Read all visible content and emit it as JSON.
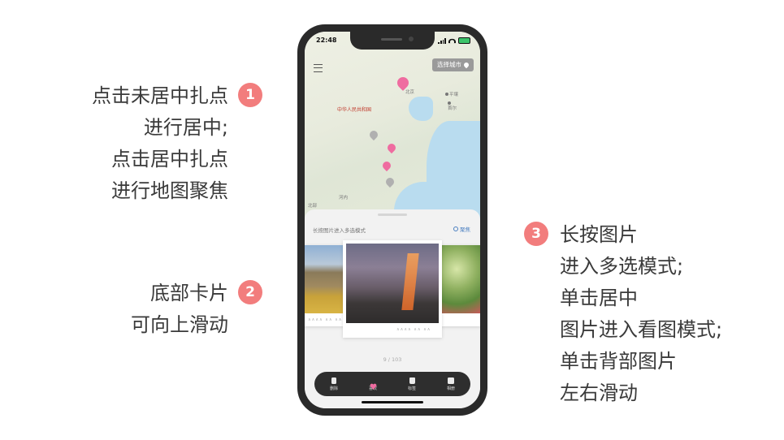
{
  "annotations": {
    "a1": {
      "number": "1",
      "lines": [
        "点击未居中扎点",
        "进行居中;",
        "点击居中扎点",
        "进行地图聚焦"
      ]
    },
    "a2": {
      "number": "2",
      "lines": [
        "底部卡片",
        "可向上滑动"
      ]
    },
    "a3": {
      "number": "3",
      "lines": [
        "长按图片",
        "进入多选模式;",
        "单击居中",
        "图片进入看图模式;",
        "单击背部图片",
        "左右滑动"
      ]
    }
  },
  "phone": {
    "status": {
      "time": "22:48"
    },
    "map": {
      "city_button": "选择城市",
      "labels": {
        "beijing": "北京",
        "pingrang": "平壤",
        "seoul": "首尔",
        "china": "中华人民共和国",
        "hanoi": "河内",
        "north": "北部"
      }
    },
    "card": {
      "hint": "长按图片进入多选模式",
      "focus": "聚焦",
      "captions": {
        "left": "∧∧∧∧  ∧∧  ∧∧",
        "center": "∧∧∧∧  ∧∧  ∧∧"
      },
      "counter": "9 / 103"
    },
    "tabs": [
      {
        "label": "删除",
        "icon": "trash-icon"
      },
      {
        "label": "喜欢",
        "icon": "heart-icon"
      },
      {
        "label": "标签",
        "icon": "tag-icon"
      },
      {
        "label": "相册",
        "icon": "album-icon"
      }
    ],
    "colors": {
      "accent": "#f27d7d",
      "pin": "#ef6ca0",
      "sea": "#b9dcef",
      "tabbar": "#2e2e2e"
    }
  }
}
